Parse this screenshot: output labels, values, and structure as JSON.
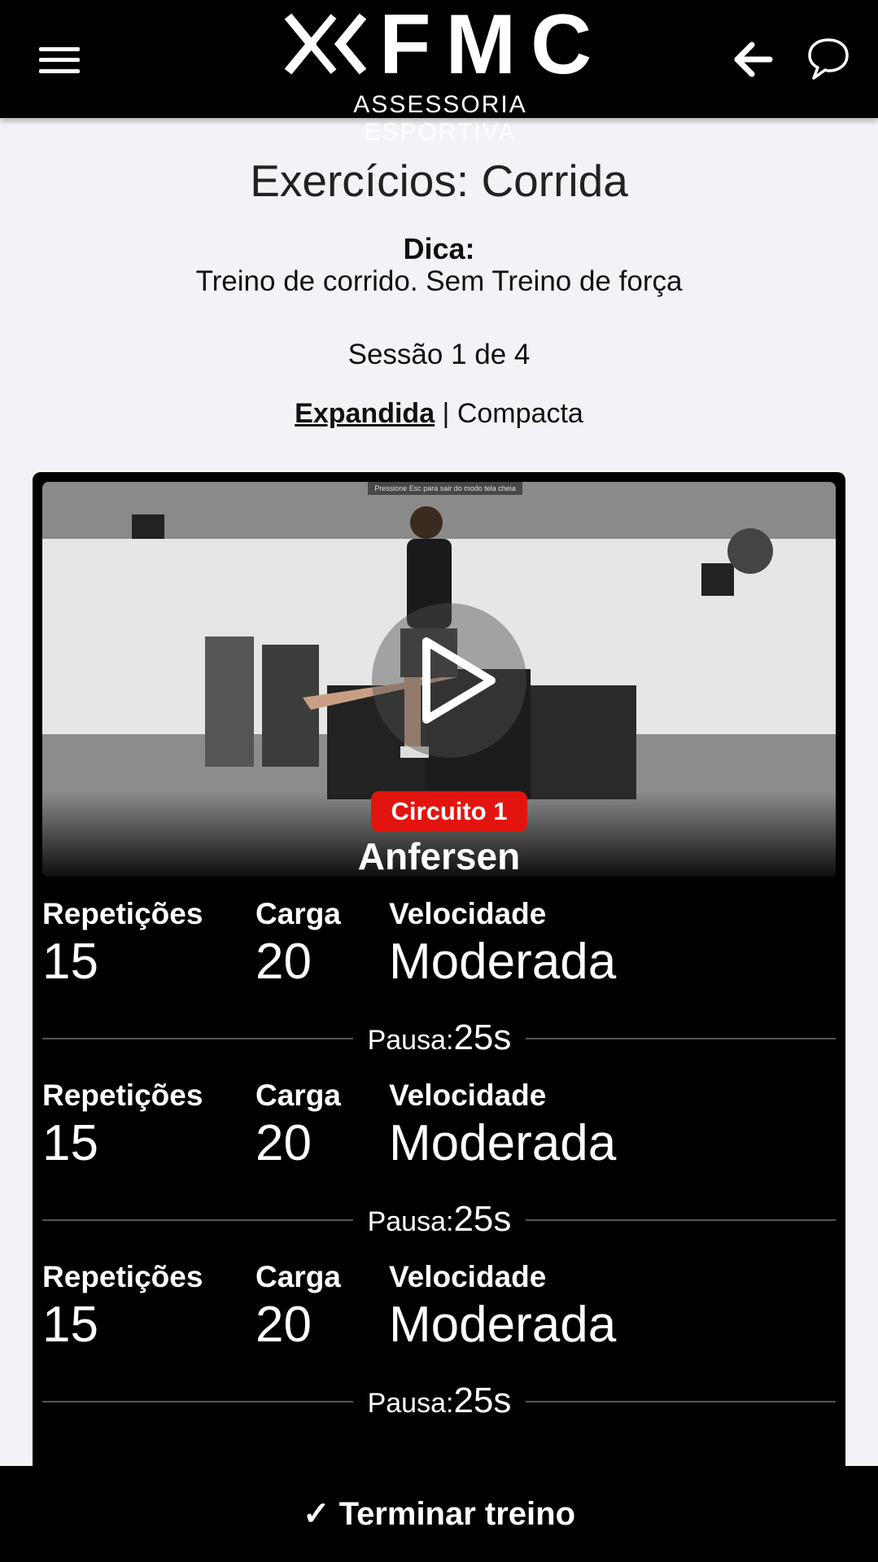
{
  "header": {
    "logo_text": "FMC",
    "logo_subtitle": "ASSESSORIA ESPORTIVA",
    "icons": [
      "menu-icon",
      "back-arrow-icon",
      "chat-icon"
    ]
  },
  "page": {
    "title": "Exercícios: Corrida",
    "tip_label": "Dica:",
    "tip_text": "Treino de corrido. Sem Treino de força",
    "session": "Sessão 1 de 4",
    "view_expanded": "Expandida",
    "view_separator": " | ",
    "view_compact": "Compacta"
  },
  "exercise": {
    "fullscreen_hint": "Pressione Esc para sair do modo tela cheia",
    "circuit": "Circuito 1",
    "name": "Anfersen",
    "sets": [
      {
        "reps_label": "Repetições",
        "reps": "15",
        "load_label": "Carga",
        "load": "20",
        "speed_label": "Velocidade",
        "speed": "Moderada",
        "pause_label": "Pausa:",
        "pause": "25s"
      },
      {
        "reps_label": "Repetições",
        "reps": "15",
        "load_label": "Carga",
        "load": "20",
        "speed_label": "Velocidade",
        "speed": "Moderada",
        "pause_label": "Pausa:",
        "pause": "25s"
      },
      {
        "reps_label": "Repetições",
        "reps": "15",
        "load_label": "Carga",
        "load": "20",
        "speed_label": "Velocidade",
        "speed": "Moderada",
        "pause_label": "Pausa:",
        "pause": "25s"
      }
    ]
  },
  "footer": {
    "finish_label": "✓ Terminar treino"
  },
  "colors": {
    "header_bg": "#000000",
    "page_bg": "#f2f2f7",
    "badge_red": "#e3140f"
  }
}
